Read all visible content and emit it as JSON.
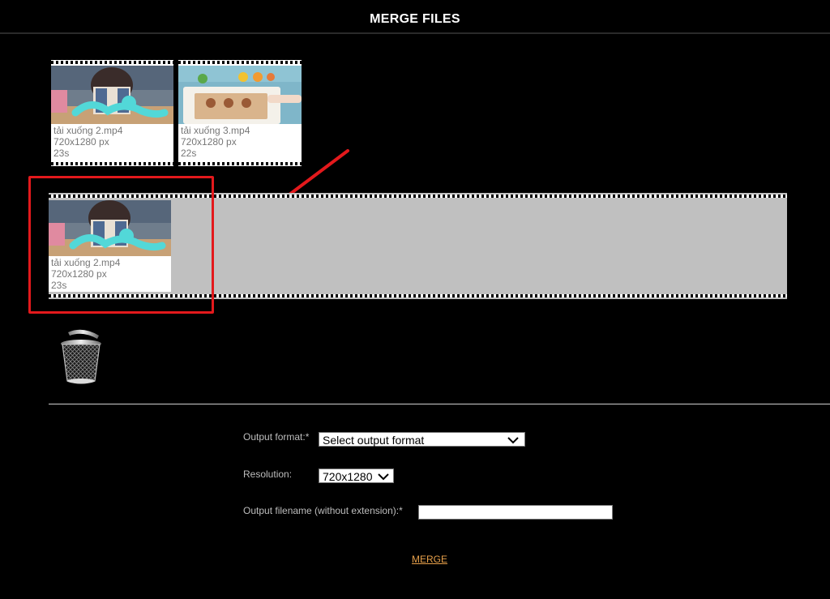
{
  "header": {
    "title": "MERGE FILES"
  },
  "library": {
    "items": [
      {
        "filename": "tải xuống 2.mp4",
        "resolution": "720x1280 px",
        "duration": "23s"
      },
      {
        "filename": "tải xuống 3.mp4",
        "resolution": "720x1280 px",
        "duration": "22s"
      }
    ]
  },
  "timeline": {
    "items": [
      {
        "filename": "tải xuống 2.mp4",
        "resolution": "720x1280 px",
        "duration": "23s"
      }
    ]
  },
  "form": {
    "output_format_label": "Output format:*",
    "output_format_value": "Select output format",
    "resolution_label": "Resolution:",
    "resolution_value": "720x1280",
    "filename_label": "Output filename (without extension):*",
    "filename_value": "",
    "merge_label": "MERGE"
  },
  "colors": {
    "background": "#000000",
    "highlight": "#e3191c",
    "timeline_bg": "#c0c0c0",
    "merge_link": "#e7a04a"
  },
  "icons": {
    "trash": "trash-can-icon",
    "dropdown": "chevron-down-icon",
    "annotation": "red-arrow-icon"
  }
}
